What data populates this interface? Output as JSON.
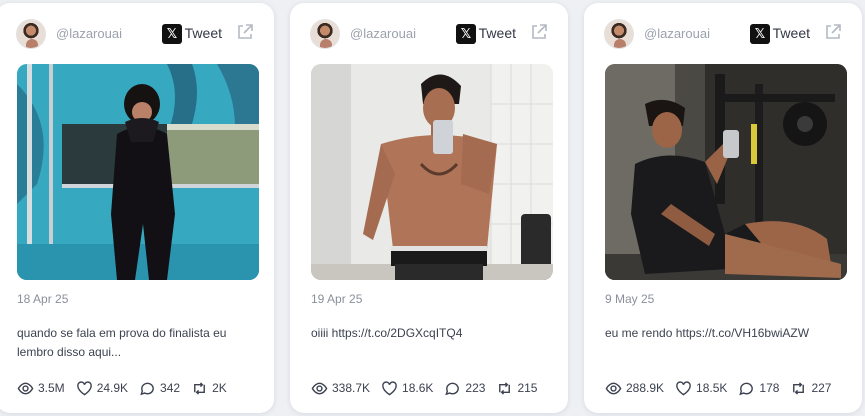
{
  "tweets": [
    {
      "handle": "@lazarouai",
      "link_label": "Tweet",
      "x_badge": "𝕏",
      "image_subject": "woman in black outfit covering face in teal forest-themed studio",
      "date": "18 Apr 25",
      "text": "quando se fala em prova do finalista eu lembro disso aqui...",
      "views": "3.5M",
      "likes": "24.9K",
      "replies": "342",
      "retweets": "2K"
    },
    {
      "handle": "@lazarouai",
      "link_label": "Tweet",
      "x_badge": "𝕏",
      "image_subject": "shirtless man taking mirror selfie in bathroom",
      "date": "19 Apr 25",
      "text": "oiiii https://t.co/2DGXcqITQ4",
      "views": "338.7K",
      "likes": "18.6K",
      "replies": "223",
      "retweets": "215"
    },
    {
      "handle": "@lazarouai",
      "link_label": "Tweet",
      "x_badge": "𝕏",
      "image_subject": "man in black t-shirt sitting on gym floor taking mirror selfie",
      "date": "9 May 25",
      "text": "eu me rendo https://t.co/VH16bwiAZW",
      "views": "288.9K",
      "likes": "18.5K",
      "replies": "178",
      "retweets": "227"
    }
  ],
  "colors": {
    "page_bg": "#eef0f4",
    "card_bg": "#ffffff",
    "muted_text": "#9ba1ad",
    "body_text": "#3c4250"
  },
  "icons": [
    "avatar",
    "x-logo-icon",
    "external-link-icon",
    "eye-icon",
    "heart-icon",
    "reply-icon",
    "retweet-icon"
  ]
}
